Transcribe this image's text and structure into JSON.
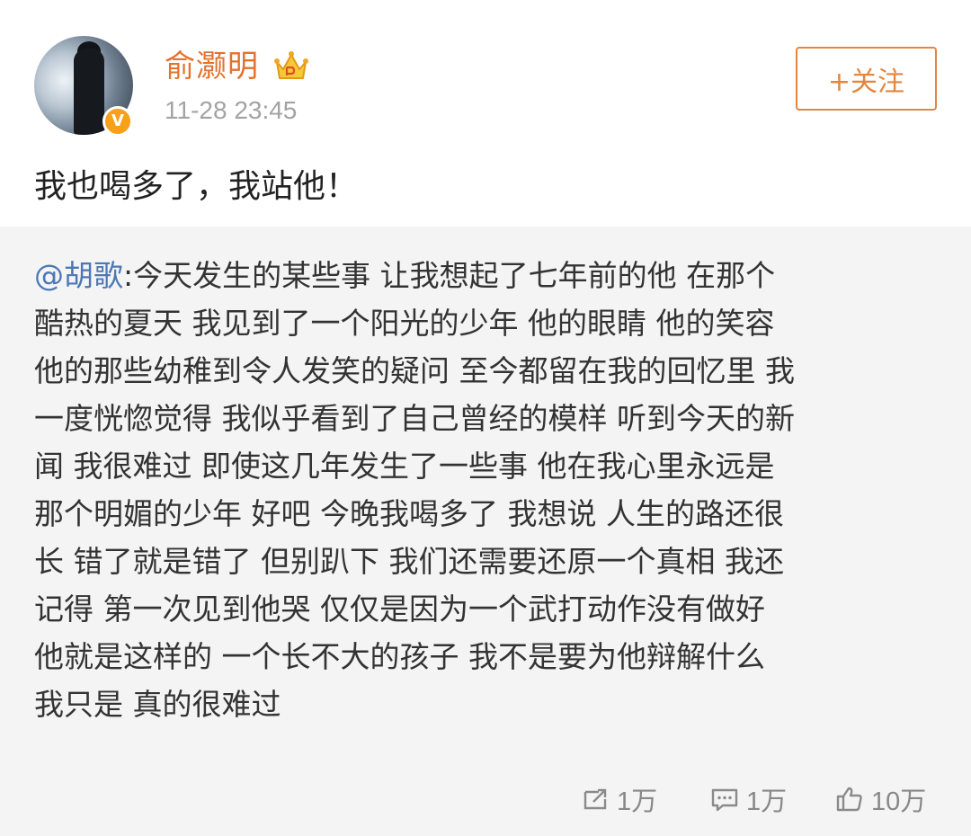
{
  "post": {
    "author": "俞灏明",
    "timestamp": "11-28 23:45",
    "follow_label": "+关注",
    "text": "我也喝多了，我站他！"
  },
  "repost": {
    "mention": "@胡歌",
    "lines": [
      ":今天发生的某些事 让我想起了七年前的他 在那个",
      "酷热的夏天 我见到了一个阳光的少年 他的眼睛 他的笑容",
      "他的那些幼稚到令人发笑的疑问 至今都留在我的回忆里 我",
      "一度恍惚觉得 我似乎看到了自己曾经的模样 听到今天的新",
      "闻 我很难过 即使这几年发生了一些事 他在我心里永远是",
      "那个明媚的少年 好吧 今晚我喝多了 我想说 人生的路还很",
      "长 错了就是错了 但别趴下 我们还需要还原一个真相 我还",
      "记得 第一次见到他哭 仅仅是因为一个武打动作没有做好",
      "他就是这样的 一个长不大的孩子 我不是要为他辩解什么",
      "我只是 真的很难过"
    ]
  },
  "actions": {
    "repost_count": "1万",
    "comment_count": "1万",
    "like_count": "10万"
  },
  "colors": {
    "author": "#e3722c",
    "follow": "#e3863f",
    "mention": "#4d78b5",
    "repost_bg": "#f4f4f4",
    "meta": "#a3a3a3"
  },
  "icons": {
    "verified": "verified-v-icon",
    "vip": "vip-crown-icon",
    "repost": "repost-icon",
    "comment": "comment-icon",
    "like": "thumbs-up-icon"
  }
}
